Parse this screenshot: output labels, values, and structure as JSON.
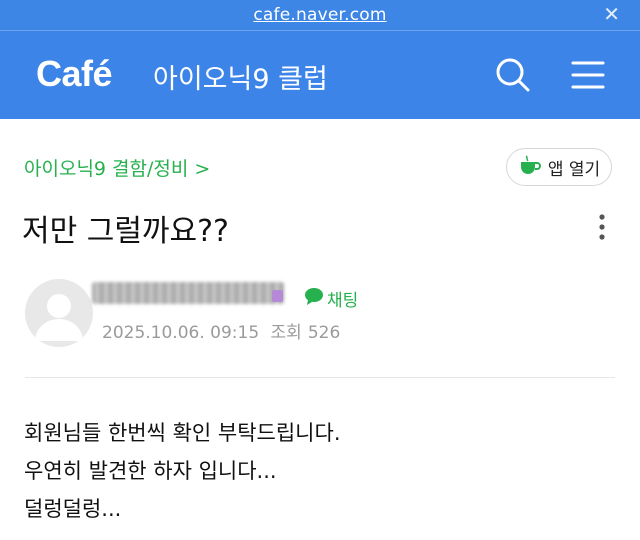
{
  "browser": {
    "url": "cafe.naver.com",
    "close_glyph": "✕"
  },
  "header": {
    "logo": "Café",
    "cafe_name": "아이오닉9 클럽",
    "icons": [
      "search-icon",
      "hamburger-menu-icon"
    ],
    "background": "#3d84e8"
  },
  "post": {
    "board_label": "아이오닉9 결함/정비 >",
    "app_button_label": "앱 열기",
    "title": "저만 그럴까요??",
    "author": {
      "name": "",
      "avatar": "default-avatar"
    },
    "chat_label": "채팅",
    "date": "2025.10.06. 09:15",
    "views_label": "조회",
    "views": "526",
    "body_lines": [
      "회원님들 한번씩 확인 부탁드립니다.",
      "우연히 발견한 하자 입니다...",
      "덜렁덜렁..."
    ]
  },
  "colors": {
    "brand_blue": "#3d84e8",
    "green": "#27b14e",
    "meta_gray": "#9a9a9a"
  }
}
